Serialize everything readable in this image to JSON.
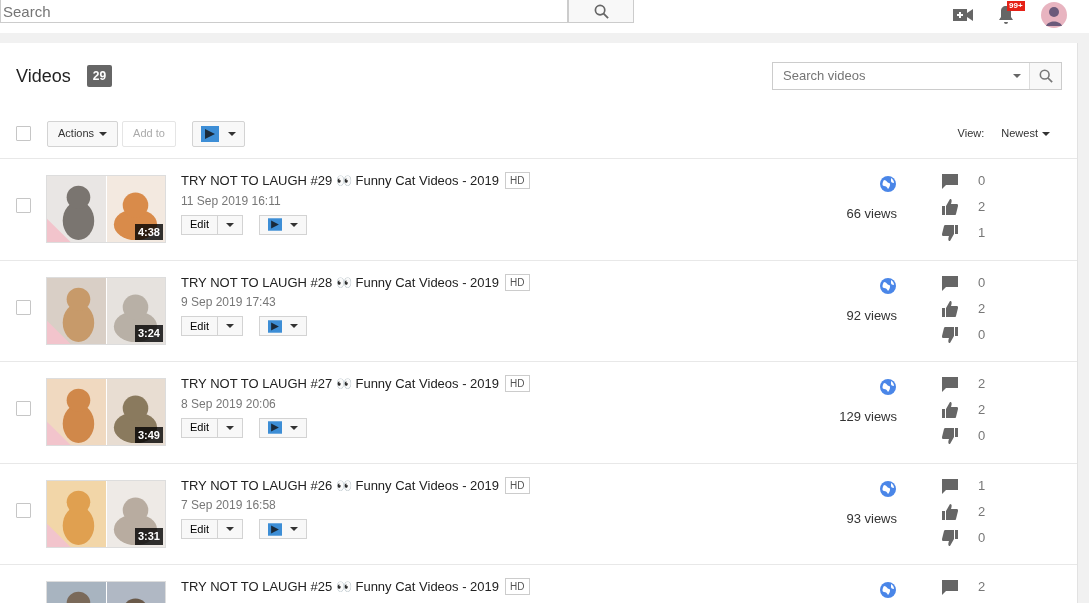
{
  "topbar": {
    "search_placeholder": "Search",
    "notifications": "99+"
  },
  "header": {
    "title": "Videos",
    "count": "29",
    "search_placeholder": "Search videos"
  },
  "toolbar": {
    "select_all": {
      "checked": false
    },
    "actions": "Actions",
    "add_to": {
      "label": "Add to",
      "disabled": true
    },
    "view_label": "View:",
    "sort": "Newest"
  },
  "videos": [
    {
      "checked": false,
      "title": "TRY NOT TO LAUGH #29 👀 Funny Cat Videos - 2019",
      "hd": "HD",
      "date": "11 Sep 2019 16:11",
      "duration": "4:38",
      "edit": "Edit",
      "views": "66 views",
      "comments": "0",
      "likes": "2",
      "dislikes": "1"
    },
    {
      "checked": false,
      "title": "TRY NOT TO LAUGH #28 👀 Funny Cat Videos - 2019",
      "hd": "HD",
      "date": "9 Sep 2019 17:43",
      "duration": "3:24",
      "edit": "Edit",
      "views": "92 views",
      "comments": "0",
      "likes": "2",
      "dislikes": "0"
    },
    {
      "checked": false,
      "title": "TRY NOT TO LAUGH #27 👀 Funny Cat Videos - 2019",
      "hd": "HD",
      "date": "8 Sep 2019 20:06",
      "duration": "3:49",
      "edit": "Edit",
      "views": "129 views",
      "comments": "2",
      "likes": "2",
      "dislikes": "0"
    },
    {
      "checked": false,
      "title": "TRY NOT TO LAUGH #26 👀 Funny Cat Videos - 2019",
      "hd": "HD",
      "date": "7 Sep 2019 16:58",
      "duration": "3:31",
      "edit": "Edit",
      "views": "93 views",
      "comments": "1",
      "likes": "2",
      "dislikes": "0"
    },
    {
      "title": "TRY NOT TO LAUGH #25 👀 Funny Cat Videos - 2019",
      "hd": "HD",
      "comments": "2"
    }
  ]
}
